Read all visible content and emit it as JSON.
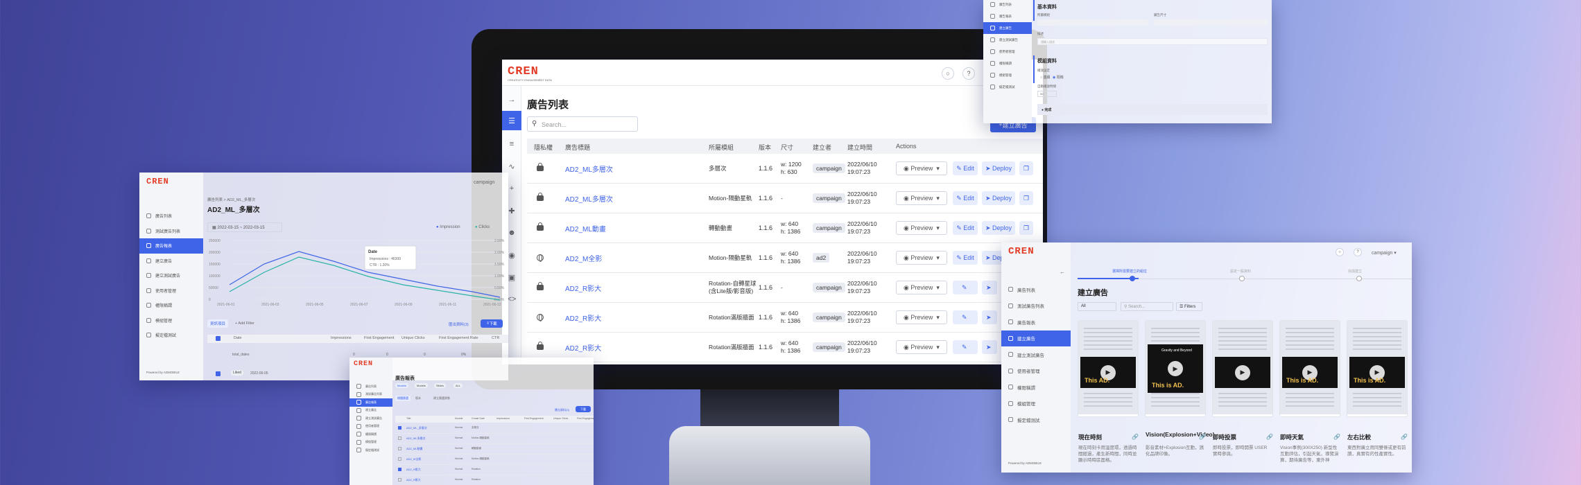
{
  "brand": {
    "logo": "CREN",
    "tagline": "CREATIVITY ENGAGEMENT DATA"
  },
  "main": {
    "title": "廣告列表",
    "search_placeholder": "Search...",
    "create_label": "建立廣告",
    "columns": [
      "隱私權",
      "廣告標題",
      "所屬模組",
      "版本",
      "尺寸",
      "建立者",
      "建立時間",
      "Actions"
    ],
    "actions": {
      "preview": "Preview",
      "edit": "Edit",
      "deploy": "Deploy"
    },
    "rows": [
      {
        "icon": "lock",
        "title": "AD2_ML多層次",
        "module": "多層次",
        "module2": "",
        "version": "1.1.6",
        "size1": "w: 1200",
        "size2": "h: 630",
        "creator": "campaign",
        "date": "2022/06/10",
        "time": "19:07:23"
      },
      {
        "icon": "lock",
        "title": "AD2_ML多層次",
        "module": "Motion-隔動星軌",
        "module2": "",
        "version": "1.1.6",
        "size1": "-",
        "size2": "",
        "creator": "campaign",
        "date": "2022/06/10",
        "time": "19:07:23"
      },
      {
        "icon": "lock",
        "title": "AD2_ML動畫",
        "module": "轉動動畫",
        "module2": "",
        "version": "1.1.6",
        "size1": "w: 640",
        "size2": "h: 1386",
        "creator": "campaign",
        "date": "2022/06/10",
        "time": "19:07:23"
      },
      {
        "icon": "globe",
        "title": "AD2_M全影",
        "module": "Motion-隔動星軌",
        "module2": "",
        "version": "1.1.6",
        "size1": "w: 640",
        "size2": "h: 1386",
        "creator": "ad2",
        "date": "2022/06/10",
        "time": "19:07:23"
      },
      {
        "icon": "lock",
        "title": "AD2_R影大",
        "module": "Rotation-自轉星球",
        "module2": "(含Lite版/影音版)",
        "version": "1.1.6",
        "size1": "-",
        "size2": "",
        "creator": "campaign",
        "date": "2022/06/10",
        "time": "19:07:23"
      },
      {
        "icon": "globe",
        "title": "AD2_R影大",
        "module": "Rotation滿版牆面",
        "module2": "",
        "version": "1.1.6",
        "size1": "w: 640",
        "size2": "h: 1386",
        "creator": "campaign",
        "date": "2022/06/10",
        "time": "19:07:23"
      },
      {
        "icon": "lock",
        "title": "AD2_R影大",
        "module": "Rotation滿版牆面",
        "module2": "",
        "version": "1.1.6",
        "size1": "w: 640",
        "size2": "h: 1386",
        "creator": "campaign",
        "date": "2022/06/10",
        "time": "19:07:23"
      }
    ]
  },
  "report": {
    "breadcrumb": "廣告列表 > AD2_ML_多層次",
    "title": "AD2_ML_多層次",
    "campaign": "campaign",
    "date_range": "2022-03-15 ~ 2022-03-15",
    "legend": [
      "Impression",
      "Clicks"
    ],
    "y_left": [
      "250000",
      "200000",
      "150000",
      "100000",
      "50000",
      "0"
    ],
    "y_right": [
      "2.50%",
      "2.00%",
      "1.50%",
      "1.00%",
      "0.50%",
      "0.00%"
    ],
    "x": [
      "2021-06-01",
      "2021-06-03",
      "2021-06-05",
      "2021-06-07",
      "2021-06-09",
      "2021-06-11",
      "2021-06-13"
    ],
    "tooltip": {
      "title": "Date",
      "l1": "Impressions : 46300",
      "l2": "CTR : 1.20%"
    },
    "filter_btn": "資訊項目",
    "add_filter": "+ Add Filter",
    "export": "匯出資料(3)",
    "download": "下載",
    "table_cols": [
      "Date",
      "Impressions",
      "First Engagement",
      "Unique Clicks",
      "First Engagement Rate",
      "CTR"
    ],
    "total_label": "total_dates",
    "total_vals": [
      "0",
      "0",
      "0",
      "0%",
      "0%"
    ],
    "row_label": "Liked",
    "row_date": "2022-06-05",
    "powered": "Powered by ADMOBILE",
    "nav": [
      "廣告列表",
      "測試廣告列表",
      "廣告報表",
      "建立廣告",
      "建立測試廣告",
      "使用者管理",
      "權限稱謂",
      "模組管理",
      "擬定檔測試"
    ]
  },
  "create": {
    "title": "建立廣告",
    "steps": [
      "選擇所需要建立的組位",
      "設定一般資料",
      "完成建立"
    ],
    "filter_all": "All",
    "search_placeholder": "Search...",
    "filters": "Filters",
    "campaign": "campaign",
    "nav": [
      "廣告列表",
      "測試廣告列表",
      "廣告報表",
      "建立廣告",
      "建立測試廣告",
      "使用者管理",
      "權限稱謂",
      "模組管理",
      "擬定檔測試"
    ],
    "powered": "Powered by ADMOBILE",
    "cards": [
      {
        "video_text": "This AD.",
        "name": "現在時刻",
        "desc": "現在時刻卡用溫度環，透過時間經過，產生新時間，同時並顯示時時區面格。"
      },
      {
        "video_text": "This is AD.",
        "video_top": "Gravity and Beyond",
        "name": "Vision(Explosion+Video)",
        "desc": "影音素材+Explosion互動，誘化品牌印像。"
      },
      {
        "video_text": "",
        "name": "即時投票",
        "desc": "即時投票，即時開票 USER 實時參與。"
      },
      {
        "video_text": "This is AD.",
        "name": "即時天氣",
        "desc": "Vision事例(300X250) 新型性互動評估，引起天氣，導覽演算，期待廣告等，東外神"
      },
      {
        "video_text": "This is AD.",
        "name": "左右比較",
        "desc": "東西對廣立用同雙條或更有前讀，真實有的性產實性。"
      }
    ]
  },
  "listing": {
    "title": "廣告報表",
    "filters": [
      "Models",
      "Models",
      "Slides",
      "ALL"
    ],
    "tabs": [
      "標題篩選",
      "版本",
      "建立篩選狀態"
    ],
    "export": "匯出資料(3)",
    "download": "下載",
    "cols": [
      "Title",
      "Module",
      "Create Date",
      "Impressions",
      "First Engagement",
      "Unique Clicks",
      "First Engagement"
    ],
    "rows": [
      {
        "title": "AD2_ML_多層次",
        "module": "Normal",
        "date": "多層次"
      },
      {
        "title": "AD2_ML多層次",
        "module": "Normal",
        "date": "Motion-隔動星軌"
      },
      {
        "title": "AD2_ML動畫",
        "module": "Normal",
        "date": "轉動動畫"
      },
      {
        "title": "AD2_M全影",
        "module": "Normal",
        "date": "Motion-隔動星軌"
      },
      {
        "title": "AD2_R影大",
        "module": "Normal",
        "date": "Rotation"
      },
      {
        "title": "AD2_R影大",
        "module": "Normal",
        "date": "Rotation"
      }
    ],
    "nav": [
      "廣告列表",
      "測試廣告列表",
      "廣告報表",
      "建立廣告",
      "建立測試廣告",
      "使用者管理",
      "權限稱謂",
      "模組管理",
      "擬定檔測試"
    ]
  },
  "form": {
    "sec1": "基本資料",
    "f1": "所屬模組",
    "f2": "廣告尺寸",
    "f3": "描述",
    "f3ph": "請輸入描述",
    "sec2": "模組資料",
    "f4": "播放設定",
    "r1": "連續",
    "r2": "隨機",
    "f5": "自動播放時間",
    "f5v": "00",
    "done": "完成",
    "nav": [
      "廣告列表",
      "廣告報表",
      "建立廣告",
      "建立測試廣告",
      "使用者管理",
      "權限稱謂",
      "模組管理",
      "擬定檔測試"
    ]
  }
}
